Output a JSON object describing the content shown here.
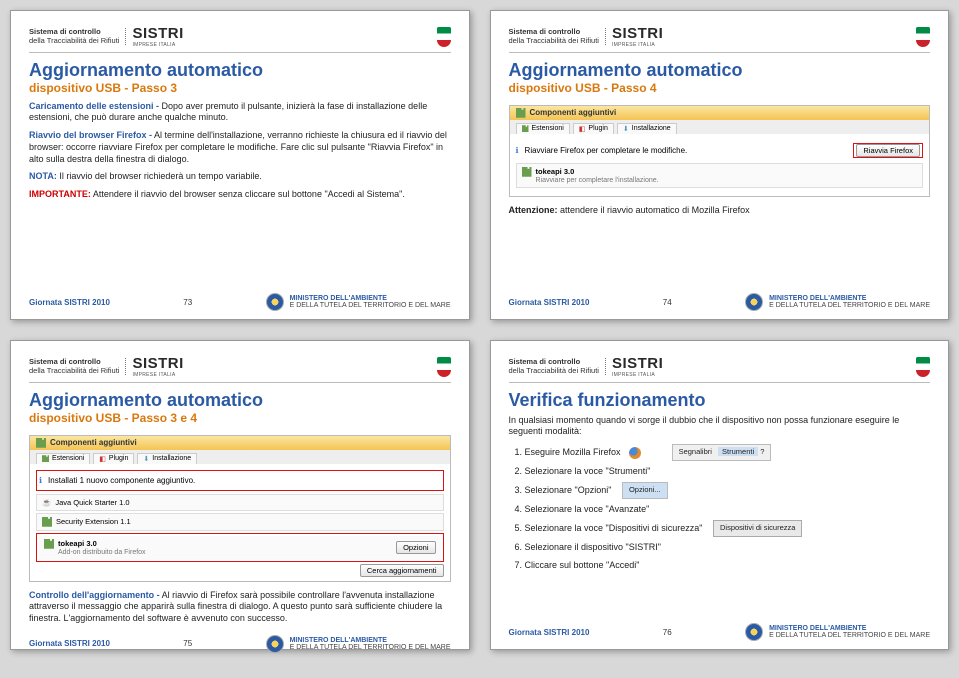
{
  "header": {
    "org_line1": "Sistema di controllo",
    "org_line2": "della Tracciabilità dei Rifiuti",
    "brand": "SISTRI",
    "brand_sub": "IMPRESE ITALIA"
  },
  "slides": {
    "s73": {
      "title": "Aggiornamento automatico",
      "subtitle": "dispositivo USB - Passo 3",
      "p1_label": "Caricamento delle estensioni -",
      "p1_text": " Dopo aver premuto il pulsante, inizierà la fase di installazione delle estensioni, che può durare anche qualche minuto.",
      "p2_label": "Riavvio del browser Firefox -",
      "p2_text": " Al termine dell'installazione, verranno richieste la chiusura ed il riavvio del browser: occorre riavviare Firefox per completare le modifiche. Fare clic sul pulsante \"Riavvia Firefox\" in alto sulla destra della finestra di dialogo.",
      "nota_label": "NOTA:",
      "nota_text": " Il riavvio del browser richiederà un tempo variabile.",
      "imp_label": "IMPORTANTE:",
      "imp_text": " Attendere il riavvio del browser senza cliccare sul bottone \"Accedi al Sistema\"."
    },
    "s74": {
      "title": "Aggiornamento automatico",
      "subtitle": "dispositivo USB - Passo 4",
      "shot_title": "Componenti aggiuntivi",
      "tab1": "Estensioni",
      "tab2": "Plugin",
      "tab3": "Installazione",
      "msg": "Riavviare Firefox per completare le modifiche.",
      "btn": "Riavvia Firefox",
      "ext_name": "tokeapi 3.0",
      "ext_sub": "Riavviare per completare l'installazione.",
      "att_label": "Attenzione:",
      "att_text": " attendere il riavvio automatico di Mozilla Firefox"
    },
    "s75": {
      "title": "Aggiornamento automatico",
      "subtitle": "dispositivo USB - Passo 3 e 4",
      "shot_title": "Componenti aggiuntivi",
      "tab1": "Estensioni",
      "tab2": "Plugin",
      "tab3": "Installazione",
      "install_hdr": "Installati 1 nuovo componente aggiuntivo.",
      "ext1": "Java Quick Starter 1.0",
      "ext2": "Security Extension 1.1",
      "ext3": "tokeapi 3.0",
      "ext3_sub": "Add-on distribuito da Firefox",
      "btn_find": "Cerca aggiornamenti",
      "btn_opts": "Opzioni",
      "p_label": "Controllo dell'aggiornamento -",
      "p_text": " Al riavvio di Firefox sarà possibile controllare l'avvenuta installazione attraverso il messaggio che apparirà sulla finestra di dialogo. A questo punto sarà sufficiente chiudere la finestra. L'aggiornamento del software è avvenuto con successo."
    },
    "s76": {
      "title": "Verifica funzionamento",
      "intro": "In qualsiasi momento quando vi sorge il dubbio che il dispositivo non possa funzionare eseguire le seguenti modalità:",
      "steps": [
        "Eseguire Mozilla Firefox",
        "Selezionare la voce \"Strumenti\"",
        "Selezionare \"Opzioni\"",
        "Selezionare la voce \"Avanzate\"",
        "Selezionare la voce \"Dispositivi di sicurezza\"",
        "Selezionare il dispositivo \"SISTRI\"",
        "Cliccare sul bottone \"Accedi\""
      ],
      "menu_strumenti": "Strumenti",
      "menu_opzioni": "Opzioni...",
      "btn_disp": "Dispositivi di sicurezza",
      "menu_bookmarks_label": "Segnalibri"
    }
  },
  "footer": {
    "label": "Giornata SISTRI 2010",
    "nums": {
      "s73": "73",
      "s74": "74",
      "s75": "75",
      "s76": "76"
    },
    "ministry_l1": "MINISTERO DELL'AMBIENTE",
    "ministry_l2": "E DELLA TUTELA DEL TERRITORIO E DEL MARE"
  }
}
